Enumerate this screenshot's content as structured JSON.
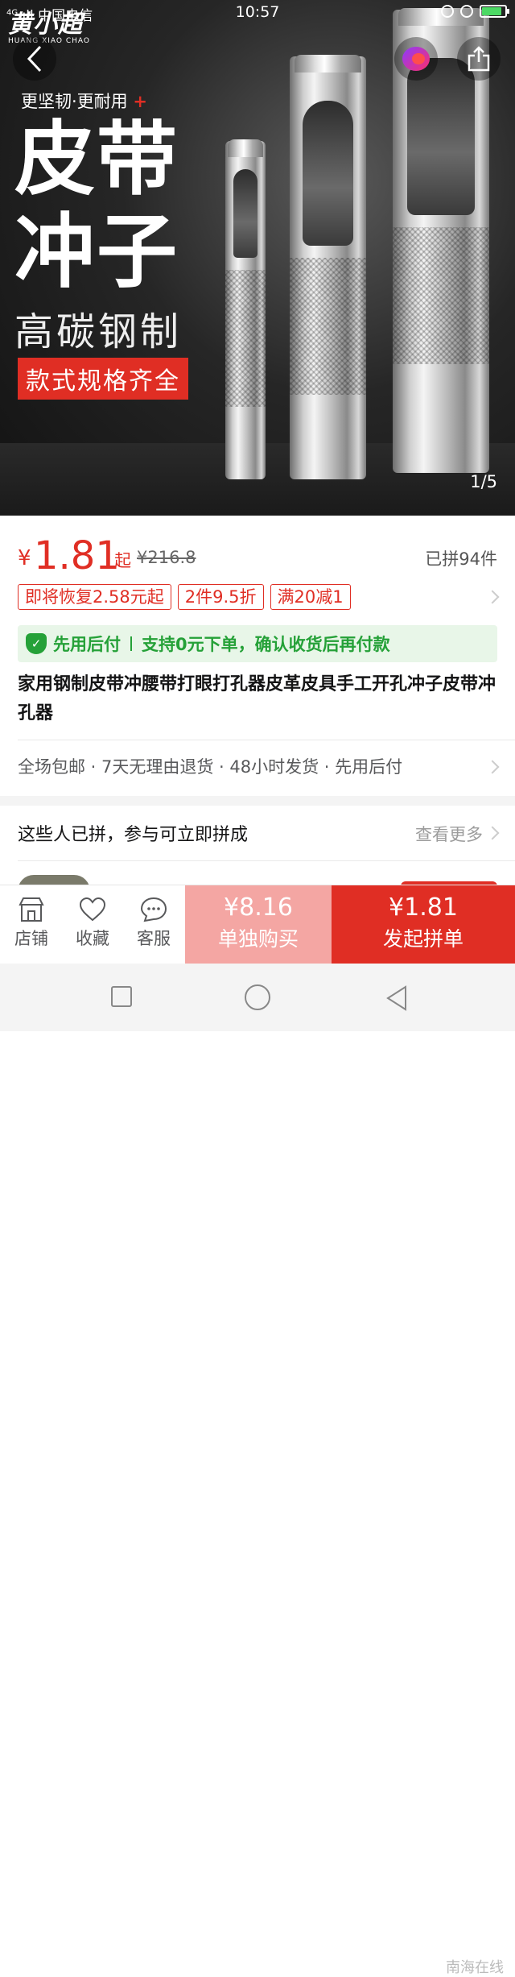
{
  "status_bar": {
    "network": "4G",
    "carrier": "中国电信",
    "time": "10:57"
  },
  "hero": {
    "brand_cn": "黄小超",
    "brand_en": "HUANG XIAO CHAO",
    "tagline": "更坚韧·更耐用",
    "tagline_plus": "+",
    "headline_line1": "皮带",
    "headline_line2": "冲子",
    "subline": "高碳钢制",
    "red_tag": "款式规格齐全",
    "page_indicator": "1/5"
  },
  "price": {
    "currency": "¥",
    "amount": "1.81",
    "qi": "起",
    "original": "¥216.8",
    "sold": "已拼94件"
  },
  "promos": [
    "即将恢复2.58元起",
    "2件9.5折",
    "满20减1"
  ],
  "pay_later": {
    "label": "先用后付",
    "text": "支持0元下单，确认收货后再付款"
  },
  "product_title": "家用钢制皮带冲腰带打眼打孔器皮革皮具手工开孔冲子皮带冲孔器",
  "services": "全场包邮 · 7天无理由退货 · 48小时发货 · 先用后付",
  "group_section": {
    "title": "这些人已拼，参与可立即拼成",
    "more": "查看更多"
  },
  "bottom_bar": {
    "store": "店铺",
    "favorite": "收藏",
    "service": "客服",
    "solo_price": "¥8.16",
    "solo_label": "单独购买",
    "group_price": "¥1.81",
    "group_label": "发起拼单"
  },
  "watermark": "南海在线",
  "colors": {
    "accent_red": "#e02e24",
    "solo_pink": "#f4a6a3",
    "green": "#25a138"
  }
}
